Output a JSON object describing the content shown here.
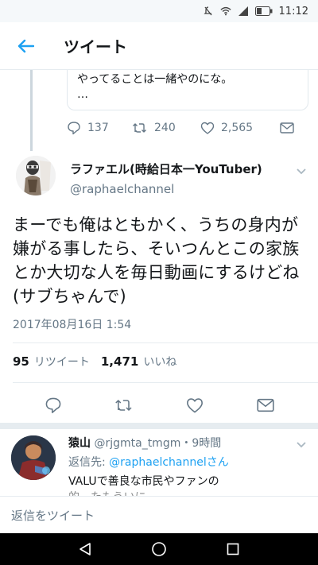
{
  "status_bar": {
    "time": "11:12"
  },
  "header": {
    "title": "ツイート"
  },
  "quoted_tweet": {
    "text": "やってることは一緒やのにな。",
    "more": "…",
    "replies": "137",
    "retweets": "240",
    "likes": "2,565"
  },
  "main_tweet": {
    "display_name": "ラファエル(時給日本一YouTuber)",
    "handle": "@raphaelchannel",
    "text": "まーでも俺はともかく、うちの身内が嫌がる事したら、そいつんとこの家族とか大切な人を毎日動画にするけどね(サブちゃんで)",
    "timestamp": "2017年08月16日 1:54",
    "retweet_count": "95",
    "retweet_label": "リツイート",
    "like_count": "1,471",
    "like_label": "いいね"
  },
  "reply_tweet": {
    "display_name": "猿山",
    "handle": "@rjgmta_tmgm",
    "separator": "・",
    "time": "9時間",
    "reply_to_label": "返信先:",
    "reply_to_mention": "@raphaelchannelさん",
    "text": "VALUで善良な市民やファンの",
    "text_cut": "的…たもういに…"
  },
  "composer": {
    "placeholder": "返信をツイート"
  },
  "colors": {
    "accent": "#1da1f2",
    "muted": "#657786",
    "text": "#14171a"
  }
}
